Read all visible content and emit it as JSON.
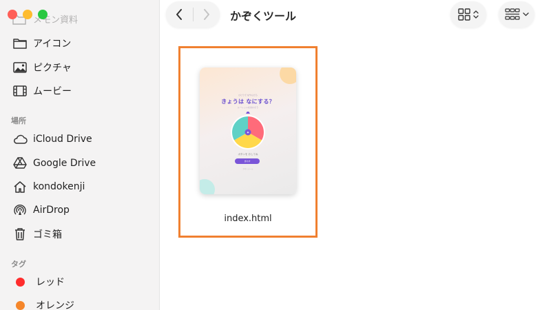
{
  "window": {
    "title": "かぞくツール"
  },
  "sidebar": {
    "partial_item": "メモン資料",
    "items": [
      {
        "label": "アイコン",
        "icon": "folder-icon"
      },
      {
        "label": "ピクチャ",
        "icon": "photo-icon"
      },
      {
        "label": "ムービー",
        "icon": "film-icon"
      }
    ],
    "locations_header": "場所",
    "locations": [
      {
        "label": "iCloud Drive",
        "icon": "cloud-icon"
      },
      {
        "label": "Google Drive",
        "icon": "google-drive-icon"
      },
      {
        "label": "kondokenji",
        "icon": "home-icon"
      },
      {
        "label": "AirDrop",
        "icon": "airdrop-icon"
      },
      {
        "label": "ゴミ箱",
        "icon": "trash-icon"
      }
    ],
    "tags_header": "タグ",
    "tags": [
      {
        "label": "レッド",
        "color": "#ff2d2d"
      },
      {
        "label": "オレンジ",
        "color": "#f5862a"
      }
    ]
  },
  "toolbar": {
    "back": "back-chevron-icon",
    "forward": "forward-chevron-icon",
    "view_mode": "grid-view-icon",
    "group_mode": "group-gallery-icon"
  },
  "content": {
    "files": [
      {
        "name": "index.html",
        "thumbnail": {
          "small_text": "ひとりで なやんだら",
          "title": "きょうは なにする？",
          "subtitle": "ルーレットをまわそう",
          "caption": "ボタンを おしてね",
          "button": "まわす",
          "footer": "かぞくツール",
          "colors": [
            "#ff6b7a",
            "#ffd84a",
            "#5fd1c6",
            "#7a55d8"
          ]
        }
      }
    ]
  },
  "colors": {
    "selection_border": "#f08030",
    "sidebar_bg": "#f4f3f3"
  }
}
